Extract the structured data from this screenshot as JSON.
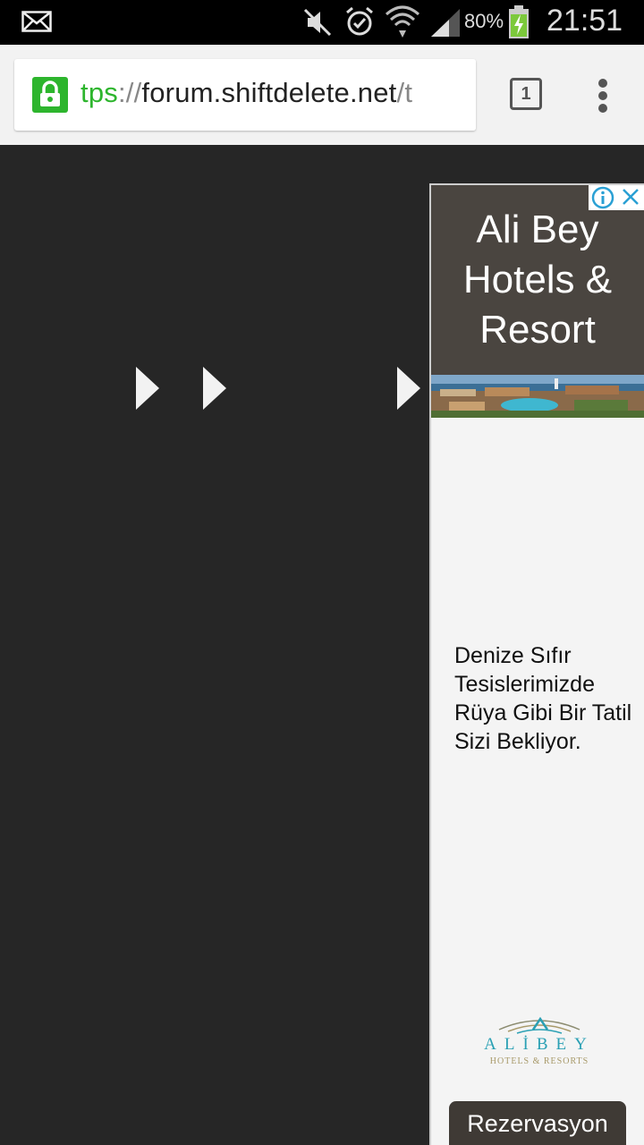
{
  "status_bar": {
    "icons": [
      "mail-icon",
      "mute-icon",
      "alarm-icon",
      "wifi-icon",
      "signal-icon",
      "battery-charging-icon"
    ],
    "battery": "80%",
    "time": "21:51"
  },
  "browser": {
    "url_scheme": "tps",
    "url_sep": "://",
    "url_host": "forum.shiftdelete.net",
    "url_path": "/t",
    "tab_count": "1",
    "secure_color": "#2db52d"
  },
  "page": {
    "background": "#262626",
    "arrows": [
      "play-arrow-icon",
      "play-arrow-icon",
      "play-arrow-icon"
    ]
  },
  "ad": {
    "title": "Ali Bey Hotels & Resort",
    "body": "Denize Sıfır Tesislerimizde Rüya Gibi Bir Tatil Sizi Bekliyor.",
    "logo_name": "ALİBEY",
    "logo_sub": "HOTELS & RESORTS",
    "cta": "Rezervasyon",
    "accent": "#2aa0b4"
  }
}
